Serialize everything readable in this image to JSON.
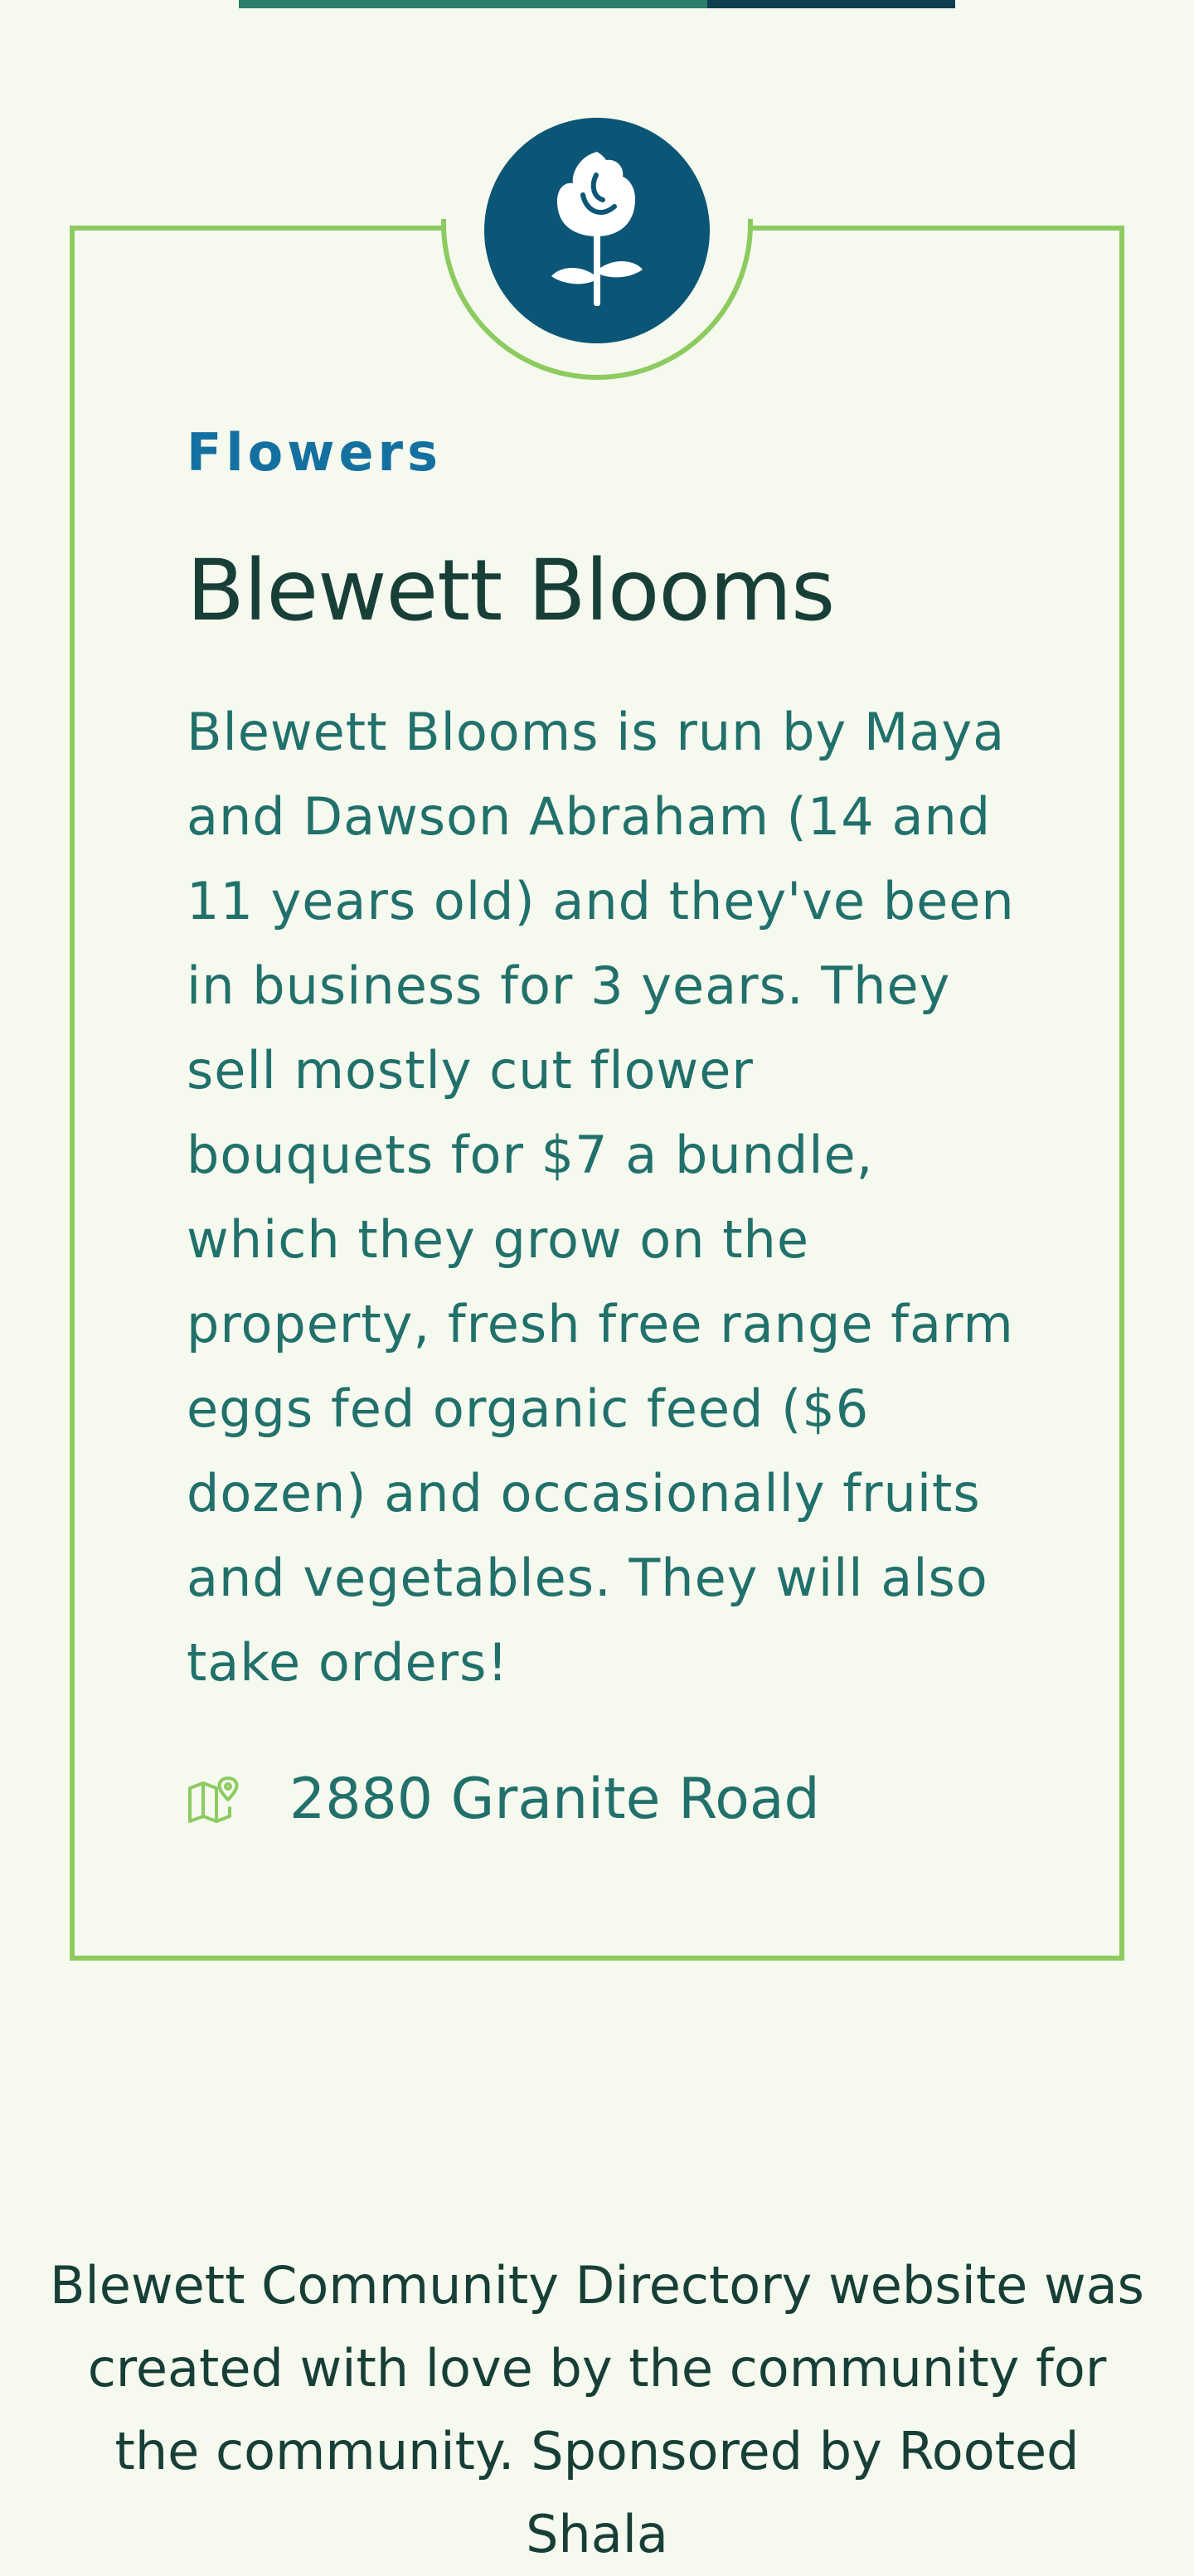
{
  "colors": {
    "page_background": "#f5f9ee",
    "border_green": "#8dcb60",
    "icon_circle": "#0b5677",
    "category_blue": "#1470a0",
    "title_dark": "#173f37",
    "body_teal": "#21706b",
    "top_bar_green": "#2a7f6a",
    "top_bar_dark": "#0e3d4f"
  },
  "card": {
    "icon": "rose-icon",
    "category": "Flowers",
    "title": "Blewett Blooms",
    "description": "Blewett Blooms is run by Maya and Dawson Abraham (14 and 11 years old) and they've been in business for 3 years. They sell mostly cut flower bouquets for $7 a bundle, which they grow on the property, fresh free range farm eggs fed organic feed ($6 dozen) and occasionally fruits and vegetables. They will also take orders!",
    "address_icon": "map-pin-icon",
    "address": "2880 Granite Road"
  },
  "footer": {
    "text": "Blewett Community Directory website was created with love by the community for the community. Sponsored by Rooted Shala"
  }
}
